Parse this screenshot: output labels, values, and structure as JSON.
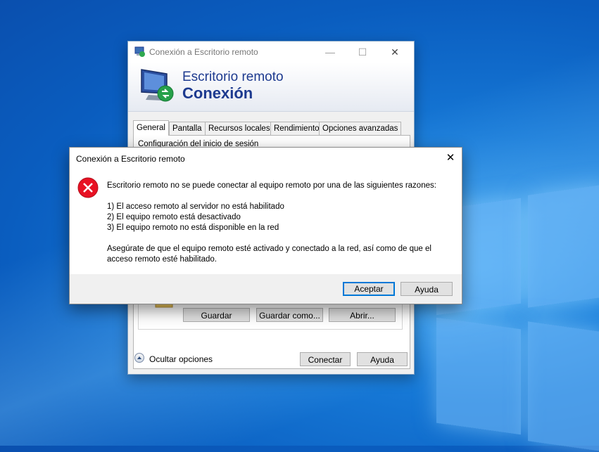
{
  "main_window": {
    "title": "Conexión a Escritorio remoto",
    "banner_line1": "Escritorio remoto",
    "banner_line2": "Conexión",
    "tabs": [
      {
        "label": "General",
        "active": true
      },
      {
        "label": "Pantalla"
      },
      {
        "label": "Recursos locales"
      },
      {
        "label": "Rendimiento"
      },
      {
        "label": "Opciones avanzadas"
      }
    ],
    "section_label": "Configuración del inicio de sesión",
    "save_label": "Guardar",
    "save_as_label": "Guardar como...",
    "open_label": "Abrir...",
    "hide_options_label": "Ocultar opciones",
    "connect_label": "Conectar",
    "help_label": "Ayuda"
  },
  "error_dialog": {
    "title": "Conexión a Escritorio remoto",
    "message_intro": "Escritorio remoto no se puede conectar al equipo remoto por una de las siguientes razones:",
    "reasons": [
      "1) El acceso remoto al servidor no está habilitado",
      "2) El equipo remoto está desactivado",
      "3) El equipo remoto no está disponible en la red"
    ],
    "message_advice": "Asegúrate de que el equipo remoto esté activado y conectado a la red, así como de que el acceso remoto esté habilitado.",
    "ok_label": "Aceptar",
    "help_label": "Ayuda"
  },
  "colors": {
    "desktop_blue": "#0a5dbf",
    "accent": "#0078d7",
    "error_red": "#e81123",
    "banner_text": "#1d3a8f"
  }
}
